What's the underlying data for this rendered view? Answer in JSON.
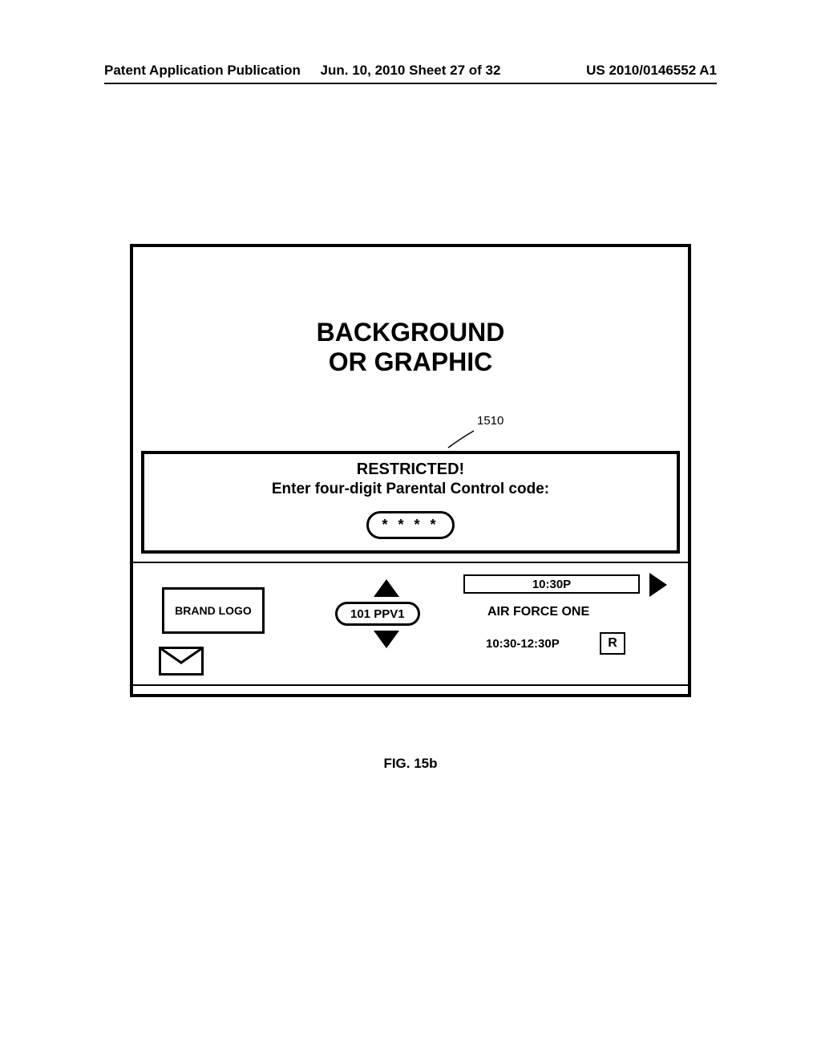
{
  "header": {
    "left": "Patent Application Publication",
    "center": "Jun. 10, 2010  Sheet 27 of 32",
    "right": "US 2010/0146552 A1"
  },
  "background_text": "BACKGROUND\nOR GRAPHIC",
  "reference_number": "1510",
  "restricted": {
    "title": "RESTRICTED!",
    "subtitle": "Enter four-digit Parental Control code:",
    "input_value": "* * * *"
  },
  "infobar": {
    "brand_logo": "BRAND LOGO",
    "channel": "101 PPV1",
    "current_time": "10:30P",
    "program_title": "AIR FORCE ONE",
    "program_time": "10:30-12:30P",
    "rating": "R"
  },
  "figure_caption": "FIG. 15b"
}
